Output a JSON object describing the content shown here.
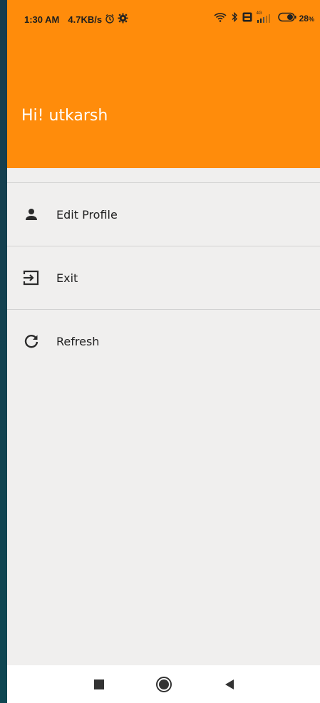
{
  "status_bar": {
    "time": "1:30 AM",
    "speed": "4.7KB/s",
    "icons_left": [
      "alarm-icon",
      "settings-icon"
    ],
    "icons_right": [
      "wifi-icon",
      "bluetooth-icon",
      "volte-icon",
      "signal-icon",
      "battery-icon"
    ],
    "network": "4G",
    "battery": "28"
  },
  "drawer": {
    "greeting": "Hi! utkarsh",
    "header_color": "#ff8c0b",
    "items": [
      {
        "label": "Edit Profile",
        "icon": "person-icon"
      },
      {
        "label": "Exit",
        "icon": "exit-icon"
      },
      {
        "label": "Refresh",
        "icon": "refresh-icon"
      }
    ]
  },
  "navbar": {
    "buttons": [
      "recent-apps-button",
      "home-button",
      "back-button"
    ]
  }
}
